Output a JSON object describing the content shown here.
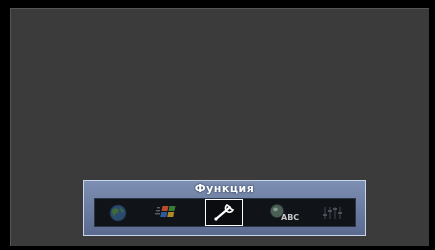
{
  "menu": {
    "title": "Функция",
    "items": [
      {
        "icon": "globe-icon",
        "selected": false
      },
      {
        "icon": "windows-flag-icon",
        "selected": false
      },
      {
        "icon": "wrench-icon",
        "selected": true
      },
      {
        "icon": "globe-abc-icon",
        "label": "ABC",
        "selected": false
      },
      {
        "icon": "equalizer-icon",
        "selected": false
      }
    ]
  },
  "colors": {
    "screen_background": "#3b3b3b",
    "menu_gradient_top": "#7d8fb2",
    "menu_gradient_bottom": "#5a6b8f",
    "menu_border": "#c8d4ea",
    "strip_background": "#101318",
    "selection_border": "#ffffff"
  }
}
